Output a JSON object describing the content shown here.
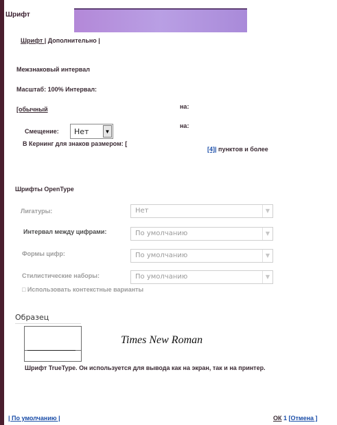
{
  "window": {
    "title": "Шрифт"
  },
  "tabs": {
    "font_tab": "Шрифт |",
    "advanced_tab": "Дополнительно |"
  },
  "spacing": {
    "heading": "Межзнаковый интервал",
    "scale_spacing": "Масштаб: 100% Интервал:",
    "spacing_value": "[обычный",
    "by_label_1": "на:",
    "by_label_2": "на:",
    "shift_label": "Смещение:",
    "shift_value": "Нет",
    "kerning_label": "В Кернинг для знаков размером: [",
    "kerning_size": "[4]|",
    "kerning_suffix": "пунктов и более"
  },
  "opentype": {
    "heading": "Шрифты OpenType",
    "ligatures_label": "Лигатуры:",
    "ligatures_value": "Нет",
    "number_spacing_label": "Интервал между цифрами:",
    "number_spacing_value": "По умолчанию",
    "number_forms_label": "Формы цифр:",
    "number_forms_value": "По умолчанию",
    "stylistic_sets_label": "Стилистические наборы:",
    "stylistic_sets_value": "По умолчанию",
    "contextual_label": "□ Использовать контекстные варианты"
  },
  "preview": {
    "heading": "Образец",
    "font_name": "Times New Roman",
    "description": "Шрифт TrueType. Он используется для вывода как на экран, так и на принтер."
  },
  "footer": {
    "default_button": "| По умолчанию |",
    "ok_button": "ОК",
    "separator": " 1 [",
    "cancel_button": "Отмена ]"
  }
}
